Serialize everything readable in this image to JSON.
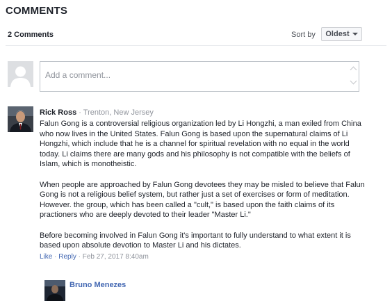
{
  "heading": "COMMENTS",
  "count_label": "2 Comments",
  "sort": {
    "label": "Sort by",
    "value": "Oldest"
  },
  "composer": {
    "placeholder": "Add a comment..."
  },
  "comments": [
    {
      "author": "Rick Ross",
      "separator": " · ",
      "location": "Trenton, New Jersey",
      "paragraphs": [
        "Falun Gong is a controversial religious organization led by Li Hongzhi, a man exiled from China who now lives in the United States. Falun Gong is based upon the supernatural claims of Li Hongzhi, which include that he is a channel for spiritual revelation with no equal in the world today. Li claims there are many gods and his philosophy is not compatible with the beliefs of Islam, which is monotheistic.",
        "When people are approached by Falun Gong devotees they may be misled to believe that Falun Gong is not a religious belief system, but rather just a set of exercises or form of meditation. However. the group, which has been called a \"cult,\" is based upon the faith claims of its practioners who are deeply devoted to their leader \"Master Li.\"",
        "Before becoming involved in Falun Gong it's important to fully understand to what extent it is based upon absolute devotion to Master Li and his dictates."
      ],
      "actions": {
        "like": "Like",
        "dot": " · ",
        "reply": "Reply",
        "timestamp": "Feb 27, 2017 8:40am"
      }
    }
  ],
  "reply": {
    "author": "Bruno Menezes"
  }
}
